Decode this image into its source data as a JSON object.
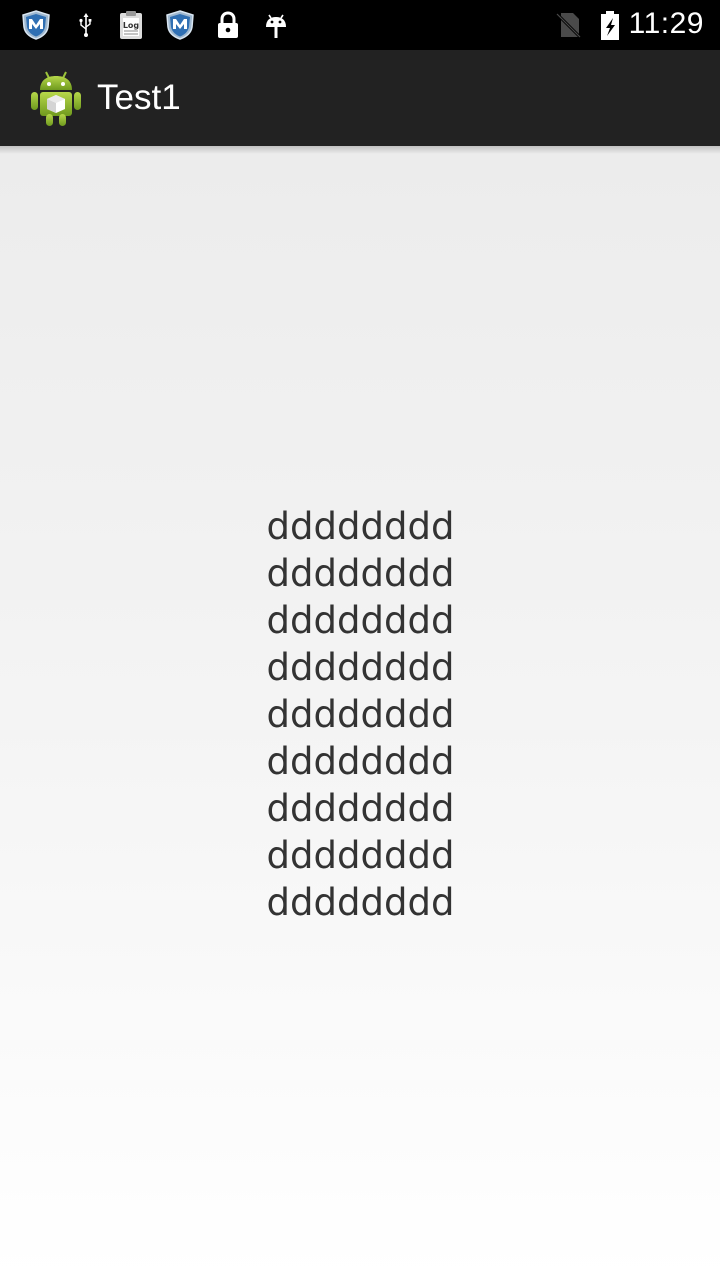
{
  "status_bar": {
    "time": "11:29",
    "left_icons": [
      "mcafee-shield-icon",
      "usb-icon",
      "log-icon",
      "mcafee-shield-icon",
      "lock-icon",
      "android-debug-icon"
    ],
    "right_icons": [
      "no-sim-icon",
      "battery-charging-icon"
    ]
  },
  "action_bar": {
    "title": "Test1",
    "icon": "android-app-icon",
    "background": "#222222"
  },
  "content": {
    "lines": [
      "dddddddd",
      "dddddddd",
      "dddddddd",
      "dddddddd",
      "dddddddd",
      "dddddddd",
      "dddddddd",
      "dddddddd",
      "dddddddd"
    ],
    "text_color": "#333333"
  }
}
